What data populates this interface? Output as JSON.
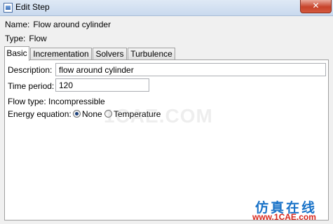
{
  "window": {
    "title": "Edit Step",
    "close_glyph": "✕"
  },
  "step": {
    "name_label": "Name:",
    "name_value": "Flow around cylinder",
    "type_label": "Type:",
    "type_value": "Flow"
  },
  "tabs": [
    {
      "label": "Basic",
      "active": true
    },
    {
      "label": "Incrementation",
      "active": false
    },
    {
      "label": "Solvers",
      "active": false
    },
    {
      "label": "Turbulence",
      "active": false
    }
  ],
  "basic": {
    "description_label": "Description:",
    "description_value": "flow around cylinder",
    "time_period_label": "Time period:",
    "time_period_value": "120",
    "flow_type_label": "Flow type:",
    "flow_type_value": "Incompressible",
    "energy_label": "Energy equation:",
    "energy_options": [
      {
        "label": "None",
        "selected": true
      },
      {
        "label": "Temperature",
        "selected": false
      }
    ]
  },
  "watermarks": {
    "center": "1CAE.COM",
    "brand_cn": "仿真在线",
    "brand_url": "www.1CAE.com"
  },
  "colors": {
    "close": "#c7432a",
    "brand_blue": "#1a73c8",
    "brand_red": "#d9261c"
  }
}
